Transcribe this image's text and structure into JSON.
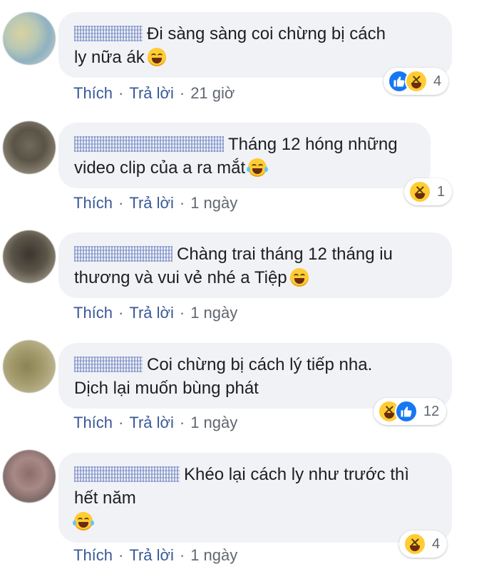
{
  "comments": [
    {
      "text_lines": [
        "Đi sàng sàng coi chừng bị cách",
        "ly nữa ák"
      ],
      "emoji_after": "grinning-squinting-face",
      "reactions": [
        "like",
        "haha"
      ],
      "reaction_count": "4",
      "like_label": "Thích",
      "reply_label": "Trả lời",
      "time": "21 giờ"
    },
    {
      "text_lines": [
        "Tháng 12 hóng những",
        "video clip của a ra mắt"
      ],
      "emoji_after": "face-with-tears-of-joy",
      "reactions": [
        "haha"
      ],
      "reaction_count": "1",
      "like_label": "Thích",
      "reply_label": "Trả lời",
      "time": "1 ngày"
    },
    {
      "text_lines": [
        "Chàng trai tháng 12 tháng iu",
        "thương và vui vẻ nhé a Tiệp"
      ],
      "emoji_after": "grinning-squinting-face",
      "reactions": [],
      "reaction_count": "",
      "like_label": "Thích",
      "reply_label": "Trả lời",
      "time": "1 ngày"
    },
    {
      "text_lines": [
        "Coi chừng bị cách lý tiếp nha.",
        "Dịch lại muốn bùng phát"
      ],
      "emoji_after": "",
      "reactions": [
        "haha",
        "like"
      ],
      "reaction_count": "12",
      "like_label": "Thích",
      "reply_label": "Trả lời",
      "time": "1 ngày"
    },
    {
      "text_lines": [
        "Khéo lại cách ly như trước thì",
        "hết năm"
      ],
      "emoji_after": "face-with-tears-of-joy",
      "reactions": [
        "haha"
      ],
      "reaction_count": "4",
      "like_label": "Thích",
      "reply_label": "Trả lời",
      "time": "1 ngày"
    }
  ],
  "colors": {
    "bubble_bg": "#f1f2f6",
    "link": "#385898",
    "meta_text": "#606770",
    "like_blue": "#1877f2",
    "haha_yellow": "#ffcc33"
  }
}
